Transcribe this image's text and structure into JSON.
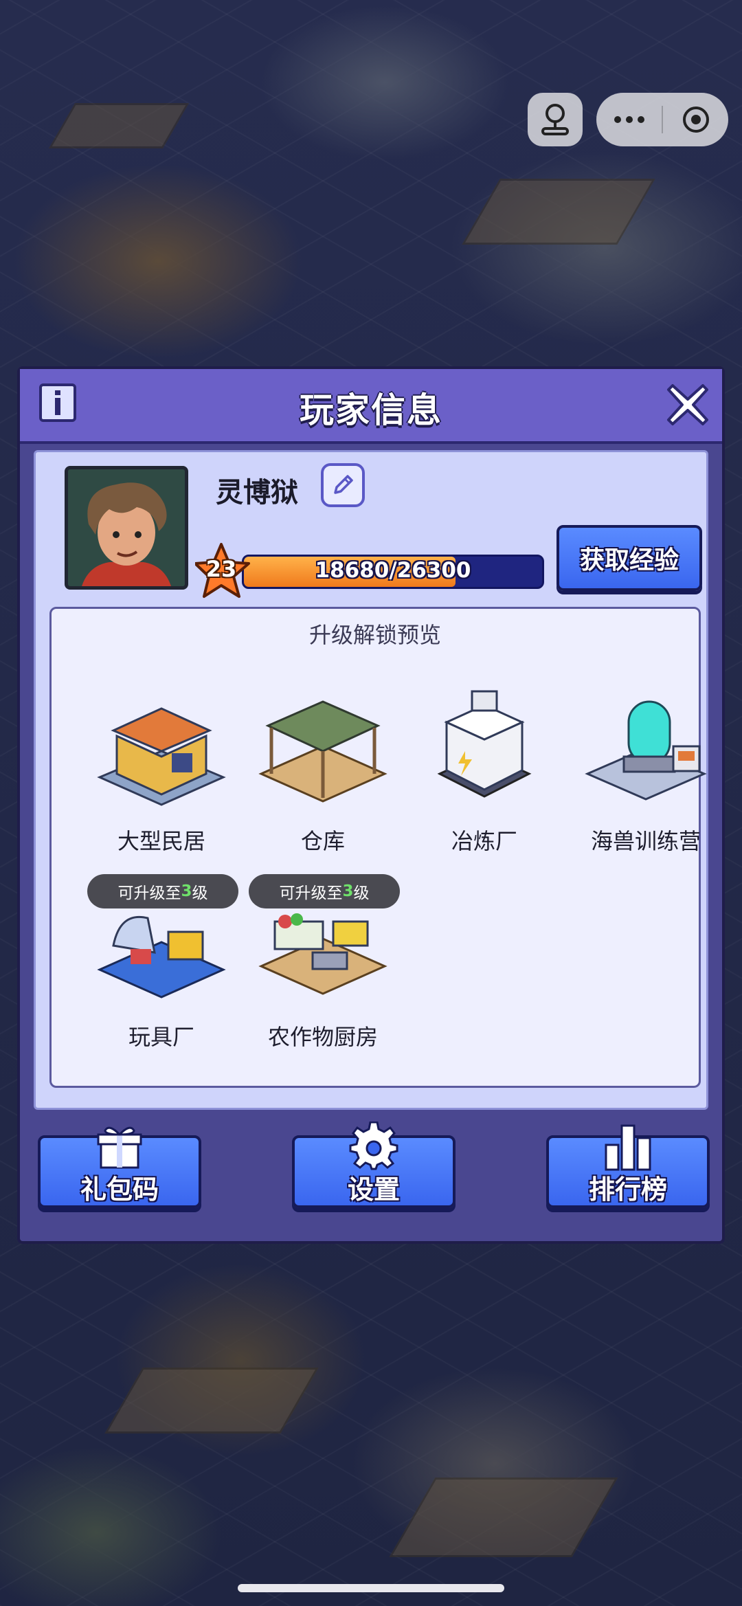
{
  "capsule": {
    "game_icon": "joystick-icon",
    "more_icon": "more-dots-icon",
    "close_icon": "record-circle-icon"
  },
  "panel": {
    "title": "玩家信息",
    "info_icon": "info-icon",
    "close_icon": "close-x-icon"
  },
  "player": {
    "name": "灵博狱",
    "edit_icon": "pencil-icon",
    "level": "23",
    "xp_text": "18680/26300",
    "xp_fraction": 0.71,
    "get_exp_label": "获取经验"
  },
  "unlock": {
    "title": "升级解锁预览",
    "buildings": [
      {
        "label": "大型民居",
        "badge": ""
      },
      {
        "label": "仓库",
        "badge": ""
      },
      {
        "label": "冶炼厂",
        "badge": ""
      },
      {
        "label": "海兽训练营",
        "badge": ""
      },
      {
        "label": "玩具厂",
        "badge_prefix": "可升级至",
        "badge_level": "3",
        "badge_suffix": "级"
      },
      {
        "label": "农作物厨房",
        "badge_prefix": "可升级至",
        "badge_level": "3",
        "badge_suffix": "级"
      }
    ]
  },
  "actions": {
    "gift_label": "礼包码",
    "gift_icon": "gift-icon",
    "settings_label": "设置",
    "settings_icon": "gear-icon",
    "rank_label": "排行榜",
    "rank_icon": "bar-chart-icon"
  },
  "colors": {
    "panel_header": "#6b60c8",
    "panel_body": "#4a4790",
    "button_blue": "#3a66ef",
    "xp_orange": "#f07a1c",
    "level_green": "#6fe06a"
  }
}
